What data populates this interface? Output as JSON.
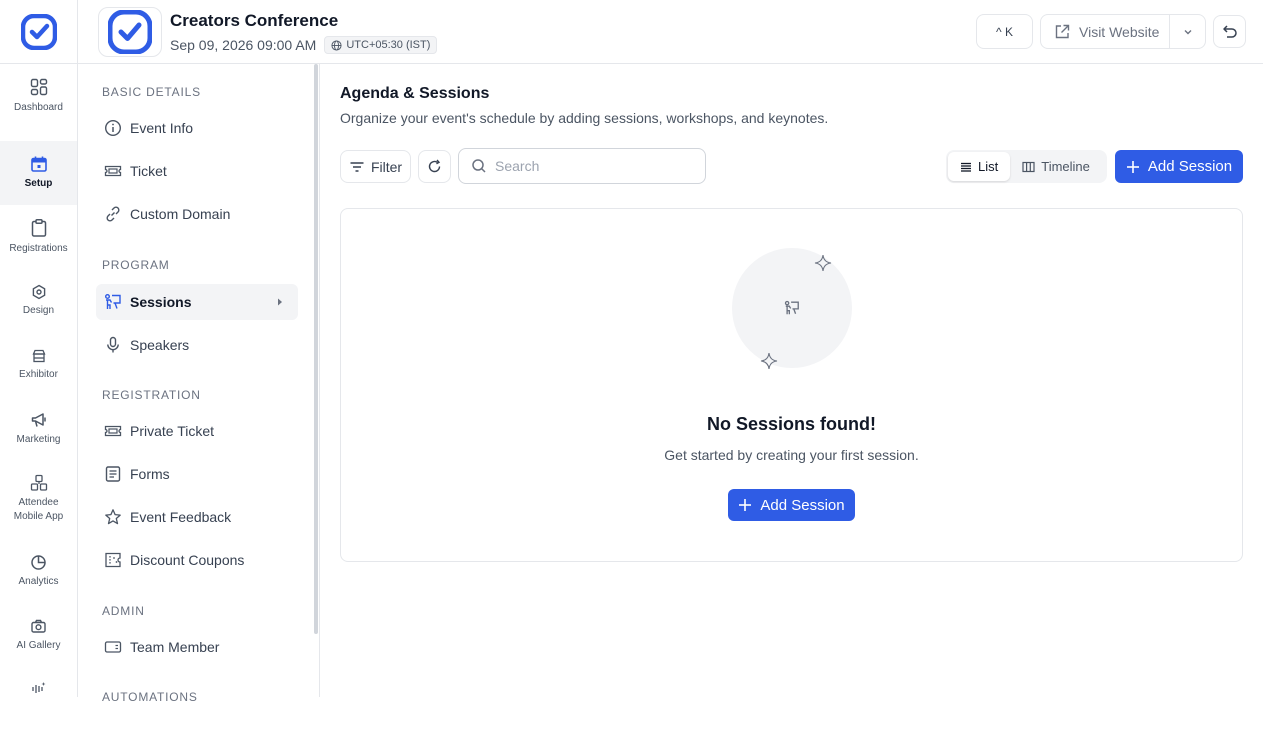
{
  "app": {
    "logo_icon": "app-logo-icon"
  },
  "event": {
    "title": "Creators Conference",
    "date": "Sep 09, 2026 09:00 AM",
    "timezone": "UTC+05:30 (IST)"
  },
  "header": {
    "shortcut_label": "^ K",
    "visit_label": "Visit Website"
  },
  "rail": {
    "items": [
      {
        "label": "Dashboard",
        "icon": "dashboard-icon"
      },
      {
        "label": "Setup",
        "icon": "calendar-icon",
        "active": true
      },
      {
        "label": "Registrations",
        "icon": "clipboard-icon"
      },
      {
        "label": "Design",
        "icon": "design-icon"
      },
      {
        "label": "Exhibitor",
        "icon": "store-icon"
      },
      {
        "label": "Marketing",
        "icon": "megaphone-icon"
      },
      {
        "label": "Attendee",
        "label2": "Mobile App",
        "icon": "mobile-app-icon"
      },
      {
        "label": "Analytics",
        "icon": "pie-chart-icon"
      },
      {
        "label": "AI Gallery",
        "icon": "camera-icon"
      }
    ]
  },
  "sidebar": {
    "sections": {
      "basic": "BASIC DETAILS",
      "program": "PROGRAM",
      "registration": "REGISTRATION",
      "admin": "ADMIN",
      "automations": "AUTOMATIONS"
    },
    "items": {
      "event_info": "Event Info",
      "ticket": "Ticket",
      "custom_domain": "Custom Domain",
      "sessions": "Sessions",
      "speakers": "Speakers",
      "private_ticket": "Private Ticket",
      "forms": "Forms",
      "event_feedback": "Event Feedback",
      "discount_coupons": "Discount Coupons",
      "team_member": "Team Member"
    }
  },
  "main": {
    "title": "Agenda & Sessions",
    "description": "Organize your event's schedule by adding sessions, workshops, and keynotes.",
    "filter_label": "Filter",
    "search_placeholder": "Search",
    "view_list": "List",
    "view_timeline": "Timeline",
    "add_session_label": "Add Session",
    "empty_title": "No Sessions found!",
    "empty_desc": "Get started by creating your first session.",
    "empty_add_label": "Add Session"
  },
  "colors": {
    "primary": "#2f5ce5",
    "border": "#e5e7eb"
  }
}
